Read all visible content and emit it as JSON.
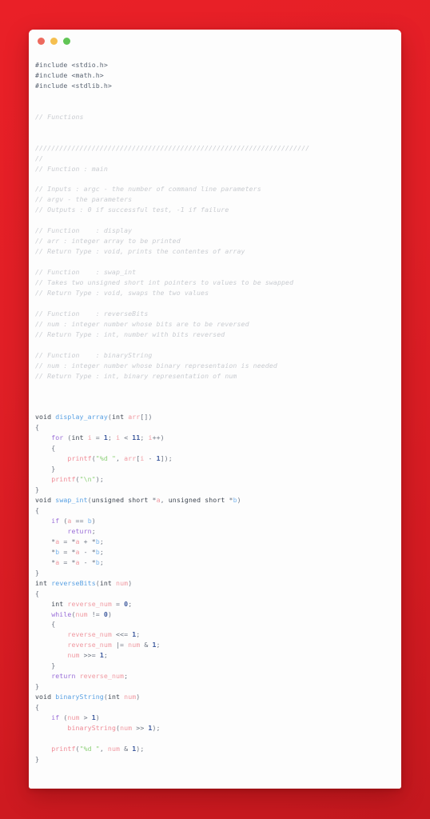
{
  "window": {
    "name": "code-editor-window",
    "traffic_lights": [
      {
        "name": "close-button",
        "label": "close",
        "color": "#ed6a5e"
      },
      {
        "name": "minimize-button",
        "label": "minimize",
        "color": "#f5bf4f"
      },
      {
        "name": "maximize-button",
        "label": "maximize",
        "color": "#61c555"
      }
    ]
  },
  "theme": {
    "background": "#e01f26",
    "editor_background": "#fdfdfd",
    "comment_color": "#c9ccd1",
    "keyword_color": "#9a6ed8",
    "function_color": "#5aa1e3",
    "string_color": "#8fd17a",
    "number_color": "#3f5b9e",
    "variable_color": "#f09aa2",
    "type_color": "#3f4752"
  },
  "code": {
    "language": "C",
    "lines": [
      "#include <stdio.h>",
      "#include <math.h>",
      "#include <stdlib.h>",
      "",
      "",
      "// Functions",
      "",
      "",
      "////////////////////////////////////////////////////////////////////",
      "//",
      "// Function : main",
      "",
      "// Inputs : argc - the number of command line parameters",
      "// argv - the parameters",
      "// Outputs : 0 if successful test, -1 if failure",
      "",
      "// Function    : display",
      "// arr : integer array to be printed",
      "// Return Type : void, prints the contentes of array",
      "",
      "// Function    : swap_int",
      "// Takes two unsigned short int pointers to values to be swapped",
      "// Return Type : void, swaps the two values",
      "",
      "// Function    : reverseBits",
      "// num : integer number whose bits are to be reversed",
      "// Return Type : int, number with bits reversed",
      "",
      "// Function    : binaryString",
      "// num : integer number whose binary representaion is needed",
      "// Return Type : int, binary representation of num",
      "",
      "",
      "",
      "void display_array(int arr[])",
      "{",
      "    for (int i = 1; i < 11; i++)",
      "    {",
      "        printf(\"%d \", arr[i - 1]);",
      "    }",
      "    printf(\"\\n\");",
      "}",
      "void swap_int(unsigned short *a, unsigned short *b)",
      "{",
      "    if (a == b)",
      "        return;",
      "    *a = *a + *b;",
      "    *b = *a - *b;",
      "    *a = *a - *b;",
      "}",
      "int reverseBits(int num)",
      "{",
      "    int reverse_num = 0;",
      "    while(num != 0)",
      "    {",
      "        reverse_num <<= 1;",
      "        reverse_num |= num & 1;",
      "        num >>= 1;",
      "    }",
      "    return reverse_num;",
      "}",
      "void binaryString(int num)",
      "{",
      "    if (num > 1)",
      "        binaryString(num >> 1);",
      "",
      "    printf(\"%d \", num & 1);",
      "}"
    ],
    "includes": [
      "stdio.h",
      "math.h",
      "stdlib.h"
    ],
    "functions": [
      "display_array",
      "swap_int",
      "reverseBits",
      "binaryString"
    ]
  }
}
